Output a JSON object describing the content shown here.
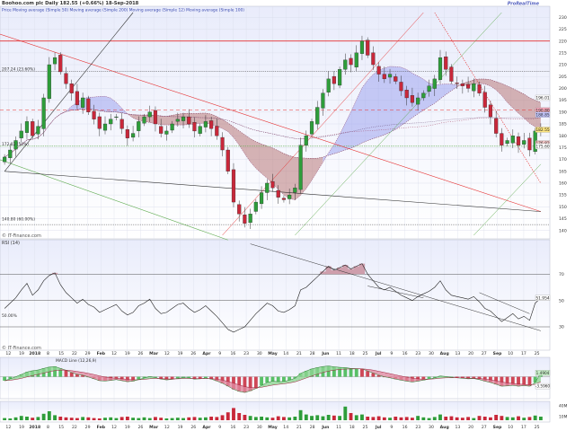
{
  "header": {
    "title": "Boohoo.com plc  Daily  182.55 (+0.66%)  18-Sep-2018",
    "logo": "ProRealTime",
    "legend_line": "Price  Moving average (Simple 50)  Moving average (Simple 200)  Moving average (Simple 12)  Moving average (Simple 100)"
  },
  "watermarks": {
    "price": "© IT-Finance.com",
    "rsi": "© IT-Finance.com"
  },
  "colors": {
    "bg_top": "#eef0fb",
    "bg_bottom": "#ffffff",
    "grid": "#d8dcea",
    "up": "#2e9d3a",
    "down": "#c8283a",
    "red_line": "#e53030",
    "band_red": "#b87878",
    "band_blue": "#9ea4ee",
    "green_line": "#5caa4c",
    "black_line": "#333333"
  },
  "chart_data": [
    {
      "type": "candlestick",
      "panel": "price",
      "ylim": [
        138,
        232
      ],
      "y_ticks": [
        140,
        145,
        150,
        155,
        160,
        165,
        170,
        175,
        180,
        185,
        190,
        195,
        200,
        205,
        210,
        215,
        220,
        225,
        230
      ],
      "x_labels": [
        "12",
        "19",
        "2018",
        "8",
        "15",
        "22",
        "29",
        "Feb",
        "12",
        "19",
        "26",
        "Mar",
        "12",
        "19",
        "26",
        "Apr",
        "9",
        "16",
        "23",
        "30",
        "May",
        "14",
        "21",
        "28",
        "Jun",
        "11",
        "18",
        "25",
        "Jul",
        "9",
        "16",
        "23",
        "30",
        "Aug",
        "13",
        "20",
        "27",
        "Sep",
        "10",
        "17",
        "25"
      ],
      "level_labels": [
        "207.24 (23.60%)",
        "172.82 (50%)",
        "140.80 (60.00%)"
      ],
      "right_tags": [
        {
          "text": "196.01",
          "color": "#ffffff"
        },
        {
          "text": "190.80",
          "color": "#f4a7b9"
        },
        {
          "text": "188.85",
          "color": "#c5c8ff"
        },
        {
          "text": "182.55",
          "color": "#ffe680"
        },
        {
          "text": "176.82",
          "color": "#f5c6c6"
        },
        {
          "text": "175.60",
          "color": "#ffffff"
        }
      ],
      "closes": [
        171,
        174,
        178,
        182,
        186,
        180,
        184,
        196,
        210,
        213,
        207,
        202,
        198,
        193,
        196,
        190,
        187,
        183,
        185,
        187,
        188,
        183,
        179,
        181,
        186,
        188,
        190,
        185,
        181,
        182,
        185,
        187,
        188,
        185,
        182,
        184,
        186,
        183,
        180,
        174,
        165,
        152,
        147,
        143,
        147,
        152,
        156,
        160,
        158,
        154,
        153,
        155,
        158,
        176,
        180,
        186,
        192,
        198,
        204,
        202,
        208,
        212,
        210,
        215,
        220,
        214,
        210,
        206,
        204,
        206,
        203,
        199,
        196,
        194,
        196,
        198,
        201,
        204,
        213,
        208,
        203,
        202,
        201,
        200,
        202,
        198,
        192,
        188,
        181,
        176,
        178,
        180,
        176,
        178,
        174,
        182,
        182.55
      ]
    },
    {
      "type": "line",
      "panel": "rsi",
      "title": "RSI (14)",
      "ylim": [
        15,
        90
      ],
      "y_ticks": [
        30,
        50,
        70
      ],
      "last_value": "51.954",
      "left_label": "50.00%",
      "values": [
        44,
        48,
        52,
        58,
        63,
        54,
        58,
        65,
        69,
        71,
        62,
        56,
        52,
        48,
        51,
        47,
        45,
        41,
        43,
        45,
        47,
        42,
        39,
        41,
        46,
        48,
        51,
        44,
        40,
        41,
        44,
        47,
        48,
        44,
        41,
        43,
        46,
        42,
        38,
        33,
        28,
        26,
        28,
        30,
        35,
        40,
        44,
        48,
        46,
        42,
        41,
        43,
        46,
        58,
        60,
        64,
        68,
        72,
        76,
        73,
        75,
        77,
        74,
        76,
        78,
        70,
        65,
        60,
        58,
        60,
        57,
        54,
        52,
        50,
        53,
        55,
        57,
        60,
        65,
        58,
        54,
        53,
        52,
        51,
        53,
        49,
        44,
        42,
        38,
        34,
        37,
        40,
        36,
        38,
        35,
        48,
        51.954
      ]
    },
    {
      "type": "histogram",
      "panel": "macd",
      "title": "MACD Line (12,26,9)",
      "ylim": [
        -7,
        5
      ],
      "last_values": [
        "1.4904",
        "-3.5960"
      ],
      "values": [
        -1.5,
        -0.8,
        0,
        0.9,
        1.8,
        2.3,
        2.6,
        3.2,
        3.7,
        3.9,
        3.2,
        2.5,
        1.6,
        0.9,
        0.6,
        -0.1,
        -0.8,
        -1.5,
        -1.6,
        -1.4,
        -1.1,
        -1.5,
        -1.9,
        -1.7,
        -1.1,
        -0.5,
        0.1,
        -0.3,
        -0.9,
        -1.2,
        -1,
        -0.6,
        -0.3,
        -0.5,
        -0.9,
        -0.8,
        -0.5,
        -0.9,
        -1.6,
        -2.5,
        -3.6,
        -4.8,
        -5.6,
        -6,
        -5.4,
        -4.5,
        -3.3,
        -2.2,
        -1.7,
        -1.9,
        -1.8,
        -1.3,
        -0.6,
        1.3,
        2.2,
        3,
        3.5,
        3.9,
        4.1,
        3.8,
        3.6,
        3.5,
        3.2,
        3.1,
        3,
        2.2,
        1.4,
        0.6,
        0,
        -0.4,
        -0.9,
        -1.3,
        -1.7,
        -2,
        -1.7,
        -1.3,
        -0.9,
        -0.4,
        0.3,
        0.1,
        -0.2,
        -0.4,
        -0.6,
        -0.8,
        -0.7,
        -1.1,
        -1.7,
        -2.2,
        -2.9,
        -3.6,
        -3.5,
        -3.3,
        -3.6,
        -3.4,
        -3.6,
        -2.2,
        1.49
      ]
    },
    {
      "type": "bar",
      "panel": "volume",
      "ylim": [
        0,
        45
      ],
      "y_ticks": [
        "10M",
        "40M"
      ],
      "values": [
        6,
        5,
        8,
        12,
        10,
        7,
        9,
        18,
        25,
        14,
        10,
        8,
        7,
        6,
        9,
        8,
        6,
        5,
        7,
        8,
        6,
        9,
        10,
        7,
        6,
        8,
        6,
        9,
        7,
        5,
        6,
        7,
        6,
        8,
        9,
        7,
        8,
        10,
        9,
        14,
        22,
        34,
        20,
        15,
        12,
        9,
        10,
        8,
        7,
        11,
        9,
        8,
        10,
        28,
        16,
        12,
        14,
        11,
        15,
        13,
        12,
        38,
        20,
        14,
        16,
        10,
        9,
        11,
        8,
        7,
        10,
        8,
        9,
        7,
        12,
        8,
        6,
        9,
        16,
        10,
        11,
        8,
        7,
        9,
        6,
        12,
        10,
        8,
        15,
        12,
        9,
        8,
        11,
        7,
        9,
        13,
        10
      ]
    }
  ]
}
